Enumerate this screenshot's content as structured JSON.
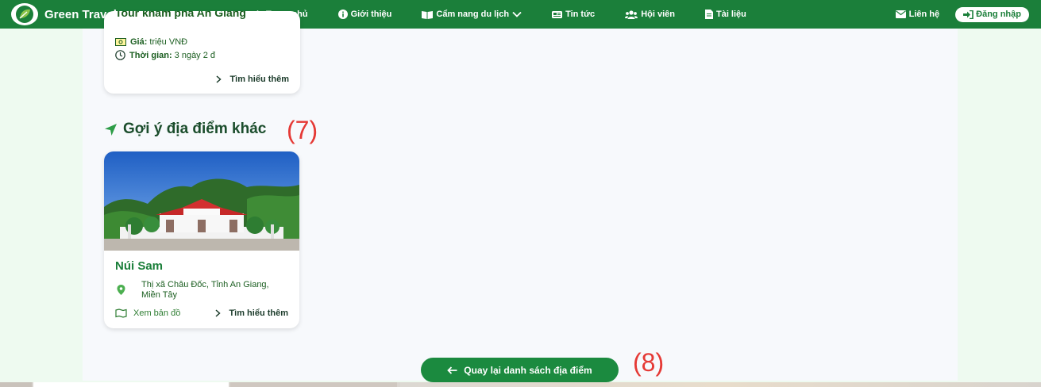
{
  "nav": {
    "brand": "Green Travel",
    "menu": [
      {
        "label": "Trang chủ",
        "icon": "home-icon"
      },
      {
        "label": "Giới thiệu",
        "icon": "info-icon"
      },
      {
        "label": "Cẩm nang du lịch",
        "icon": "book-icon"
      },
      {
        "label": "Tin tức",
        "icon": "newspaper-icon"
      },
      {
        "label": "Hội viên",
        "icon": "users-icon"
      },
      {
        "label": "Tài liệu",
        "icon": "document-icon"
      }
    ],
    "contact": "Liên hệ",
    "login": "Đăng nhập"
  },
  "prev_card": {
    "title": "Tour khám phá An Giang",
    "price_label": "Giá:",
    "price_value": "triệu VNĐ",
    "time_label": "Thời gian:",
    "time_value": "3 ngày 2 đ",
    "more": "Tìm hiểu thêm"
  },
  "section": {
    "title": "Gợi ý địa điểm khác",
    "annotation": "(7)"
  },
  "place": {
    "name": "Núi Sam",
    "address": "Thị xã Châu Đốc, Tỉnh An Giang, Miền Tây",
    "map_link": "Xem bản đồ",
    "more": "Tìm hiểu thêm"
  },
  "back": {
    "label": "Quay lại danh sách địa điểm",
    "annotation": "(8)"
  },
  "colors": {
    "brand": "#1b7f3a",
    "annotation": "#e53935"
  }
}
